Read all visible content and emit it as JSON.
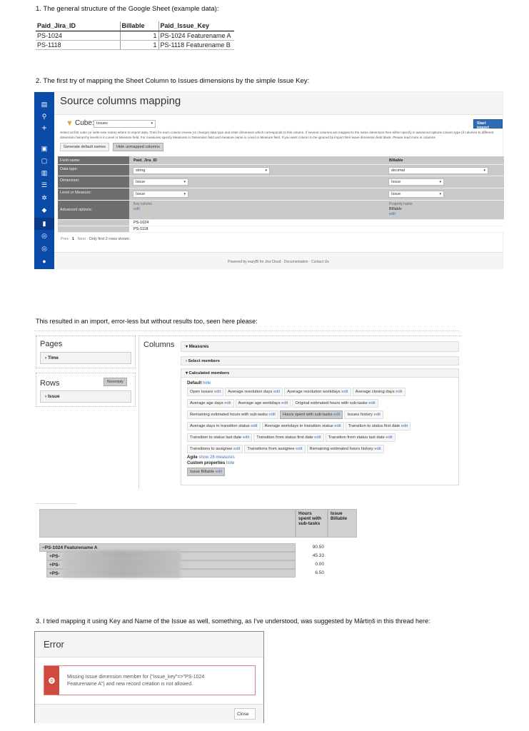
{
  "headings": {
    "h1": "1. The general structure of the Google Sheet (example data):",
    "h2": "2. The first try of mapping the Sheet Column to Issues dimensions by the simple Issue Key:",
    "h_result": "This resulted in an import, error-less but without results too, seen here please:",
    "h3": "3. I tried mapping it using Key and Name of the Issue as well, something, as I've understood, was suggested by Mārtiņš in this thread here:"
  },
  "sheet": {
    "headers": [
      "Paid_Jira_ID",
      "Billable",
      "Paid_Issue_Key"
    ],
    "rows": [
      [
        "PS-1024",
        "1",
        "PS-1024 Featurename A"
      ],
      [
        "PS-1118",
        "1",
        "PS-1118 Featurename B"
      ]
    ]
  },
  "mapping": {
    "title": "Source columns mapping",
    "cube_label": "Cube:",
    "cube_value": "Issues",
    "start_import": "Start import",
    "description": "Select at first cube (or write new name) where to import data. Then for each column review (or change) data type and enter dimension which corresponds to this column. If several columns are mapped to the same dimension then either specify in advanced options column type (if columns to different dimension hierarchy levels in in Level or Measure field. For measures specify Measures in Dimension field and measure name in Level or Measure field. If you want column to be ignored by import then leave dimension field blank. Please read more in columns",
    "generate_btn": "Generate default names",
    "hide_btn": "Hide unmapped columns",
    "labels": {
      "field": "Field name:",
      "type": "Data type:",
      "dimension": "Dimension:",
      "level": "Level or Measure:",
      "advanced": "Advanced options:"
    },
    "col1": {
      "name": "Paid_Jira_ID",
      "type": "string",
      "dimension": "Issue",
      "level": "Issue",
      "adv_caption": "Key column",
      "adv_link": "edit"
    },
    "col2": {
      "name": "Billable",
      "type": "decimal",
      "dimension": "Issue",
      "level": "Issue",
      "adv_caption": "Property name",
      "adv_value": "Billable",
      "adv_link": "edit"
    },
    "data_rows": [
      "PS-1024",
      "PS-1118"
    ],
    "pager": {
      "prev": "Prev",
      "page": "1",
      "next": "Next",
      "note": "Only first 2 rows shown."
    },
    "footer": {
      "powered": "Powered by eazyBI for Jira Cloud",
      "docs": "Documentation",
      "contact": "Contact Us"
    }
  },
  "analysis": {
    "pages_title": "Pages",
    "pages_item": "Time",
    "rows_title": "Rows",
    "nonempty": "Nonempty",
    "rows_item": "Issue",
    "columns_title": "Columns",
    "measures": "Measures",
    "select_members": "Select members",
    "calculated_members": "Calculated members",
    "default_label": "Default",
    "hide": "hide",
    "edit": "edit",
    "chips": [
      "Open issues",
      "Average resolution days",
      "Average resolution workdays",
      "Average closing days",
      "Average age days",
      "Average age workdays",
      "Original estimated hours with sub-tasks",
      "Remaining estimated hours with sub-tasks",
      "Hours spent with sub-tasks",
      "Issues history",
      "Average days in transition status",
      "Average workdays in transition status",
      "Transition to status first date",
      "Transition to status last date",
      "Transition from status first date",
      "Transition from status last date",
      "Transitions to assignee",
      "Transitions from assignee",
      "Remaining estimated hours history"
    ],
    "selected_chip": "Hours spent with sub-tasks",
    "agile_label": "Agile",
    "agile_link": "show 28 measures",
    "custom_label": "Custom properties",
    "custom_chip": "Issue Billable"
  },
  "pivot": {
    "col_headers": [
      "Hours spent with sub-tasks",
      "Issue Billable"
    ],
    "rows": [
      {
        "label": "−PS-1024 Featurename A",
        "value": "90.50"
      },
      {
        "label": "+PS-",
        "value": "45.33"
      },
      {
        "label": "+PS-",
        "value": "0.00"
      },
      {
        "label": "+PS-",
        "value": "6.50"
      }
    ]
  },
  "error": {
    "title": "Error",
    "message": "Missing Issue dimension member for {\"issue_key\"=>\"PS-1024 Featurename A\"} and new record creation is not allowed.",
    "close": "Close",
    "accent": "#d9534f"
  }
}
